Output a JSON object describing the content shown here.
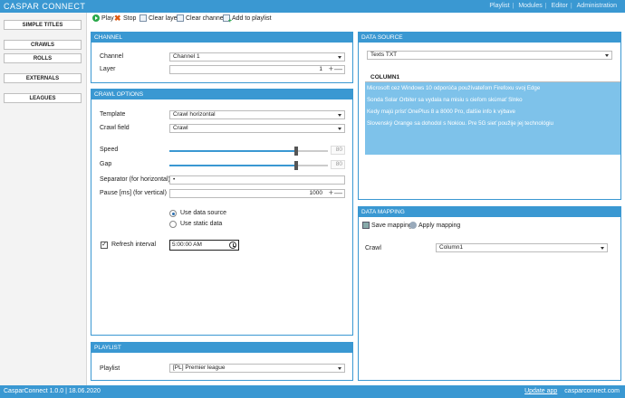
{
  "app": {
    "title": "CASPAR CONNECT",
    "menu": [
      "Playlist",
      "Modules",
      "Editor",
      "Administration"
    ]
  },
  "sidebar": {
    "items": [
      "SIMPLE TITLES",
      "CRAWLS",
      "ROLLS",
      "EXTERNALS",
      "LEAGUES"
    ]
  },
  "toolbar": {
    "play": "Play",
    "stop": "Stop",
    "clear_layer": "Clear layer",
    "clear_channel": "Clear channel",
    "add_to_playlist": "Add to playlist"
  },
  "channel": {
    "header": "CHANNEL",
    "channel_label": "Channel",
    "channel_value": "Channel 1",
    "layer_label": "Layer",
    "layer_value": "1"
  },
  "crawl": {
    "header": "CRAWL OPTIONS",
    "template_label": "Template",
    "template_value": "Crawl horizontal",
    "field_label": "Crawl field",
    "field_value": "Crawl",
    "speed_label": "Speed",
    "speed_value": "80",
    "speed_level": 0.8,
    "gap_label": "Gap",
    "gap_value": "80",
    "gap_level": 0.8,
    "separator_label": "Separator (for horizontal)",
    "separator_value": "•",
    "pause_label": "Pause [ms] (for vertical)",
    "pause_value": "1000",
    "use_data_source": "Use data source",
    "use_static_data": "Use static data",
    "refresh_label": "Refresh interval",
    "refresh_checked": true,
    "refresh_value": "5:00:00 AM"
  },
  "playlist": {
    "header": "PLAYLIST",
    "label": "Playlist",
    "value": "[PL] Premier league"
  },
  "data_source": {
    "header": "DATA SOURCE",
    "source_value": "Texts TXT",
    "column": "COLUMN1",
    "rows": [
      "Microsoft cez Windows 10 odporúča používateľom Firefoxu svoj Edge",
      "Sonda Solar Orbiter sa vydala na misiu s cieľom skúmať Slnko",
      "Kedy majú prísť OnePlus 8 a 8000 Pro, ďalšie info k výbave",
      "Slovenský Orange sa dohodol s Nokiou. Pre 5G sieť použije jej technológiu"
    ]
  },
  "data_mapping": {
    "header": "DATA MAPPING",
    "save": "Save mapping",
    "apply": "Apply mapping",
    "crawl_label": "Crawl",
    "crawl_value": "Column1"
  },
  "status": {
    "version": "CasparConnect 1.0.0",
    "date": "18.06.2020",
    "update": "Update app",
    "site": "casparconnect.com"
  }
}
